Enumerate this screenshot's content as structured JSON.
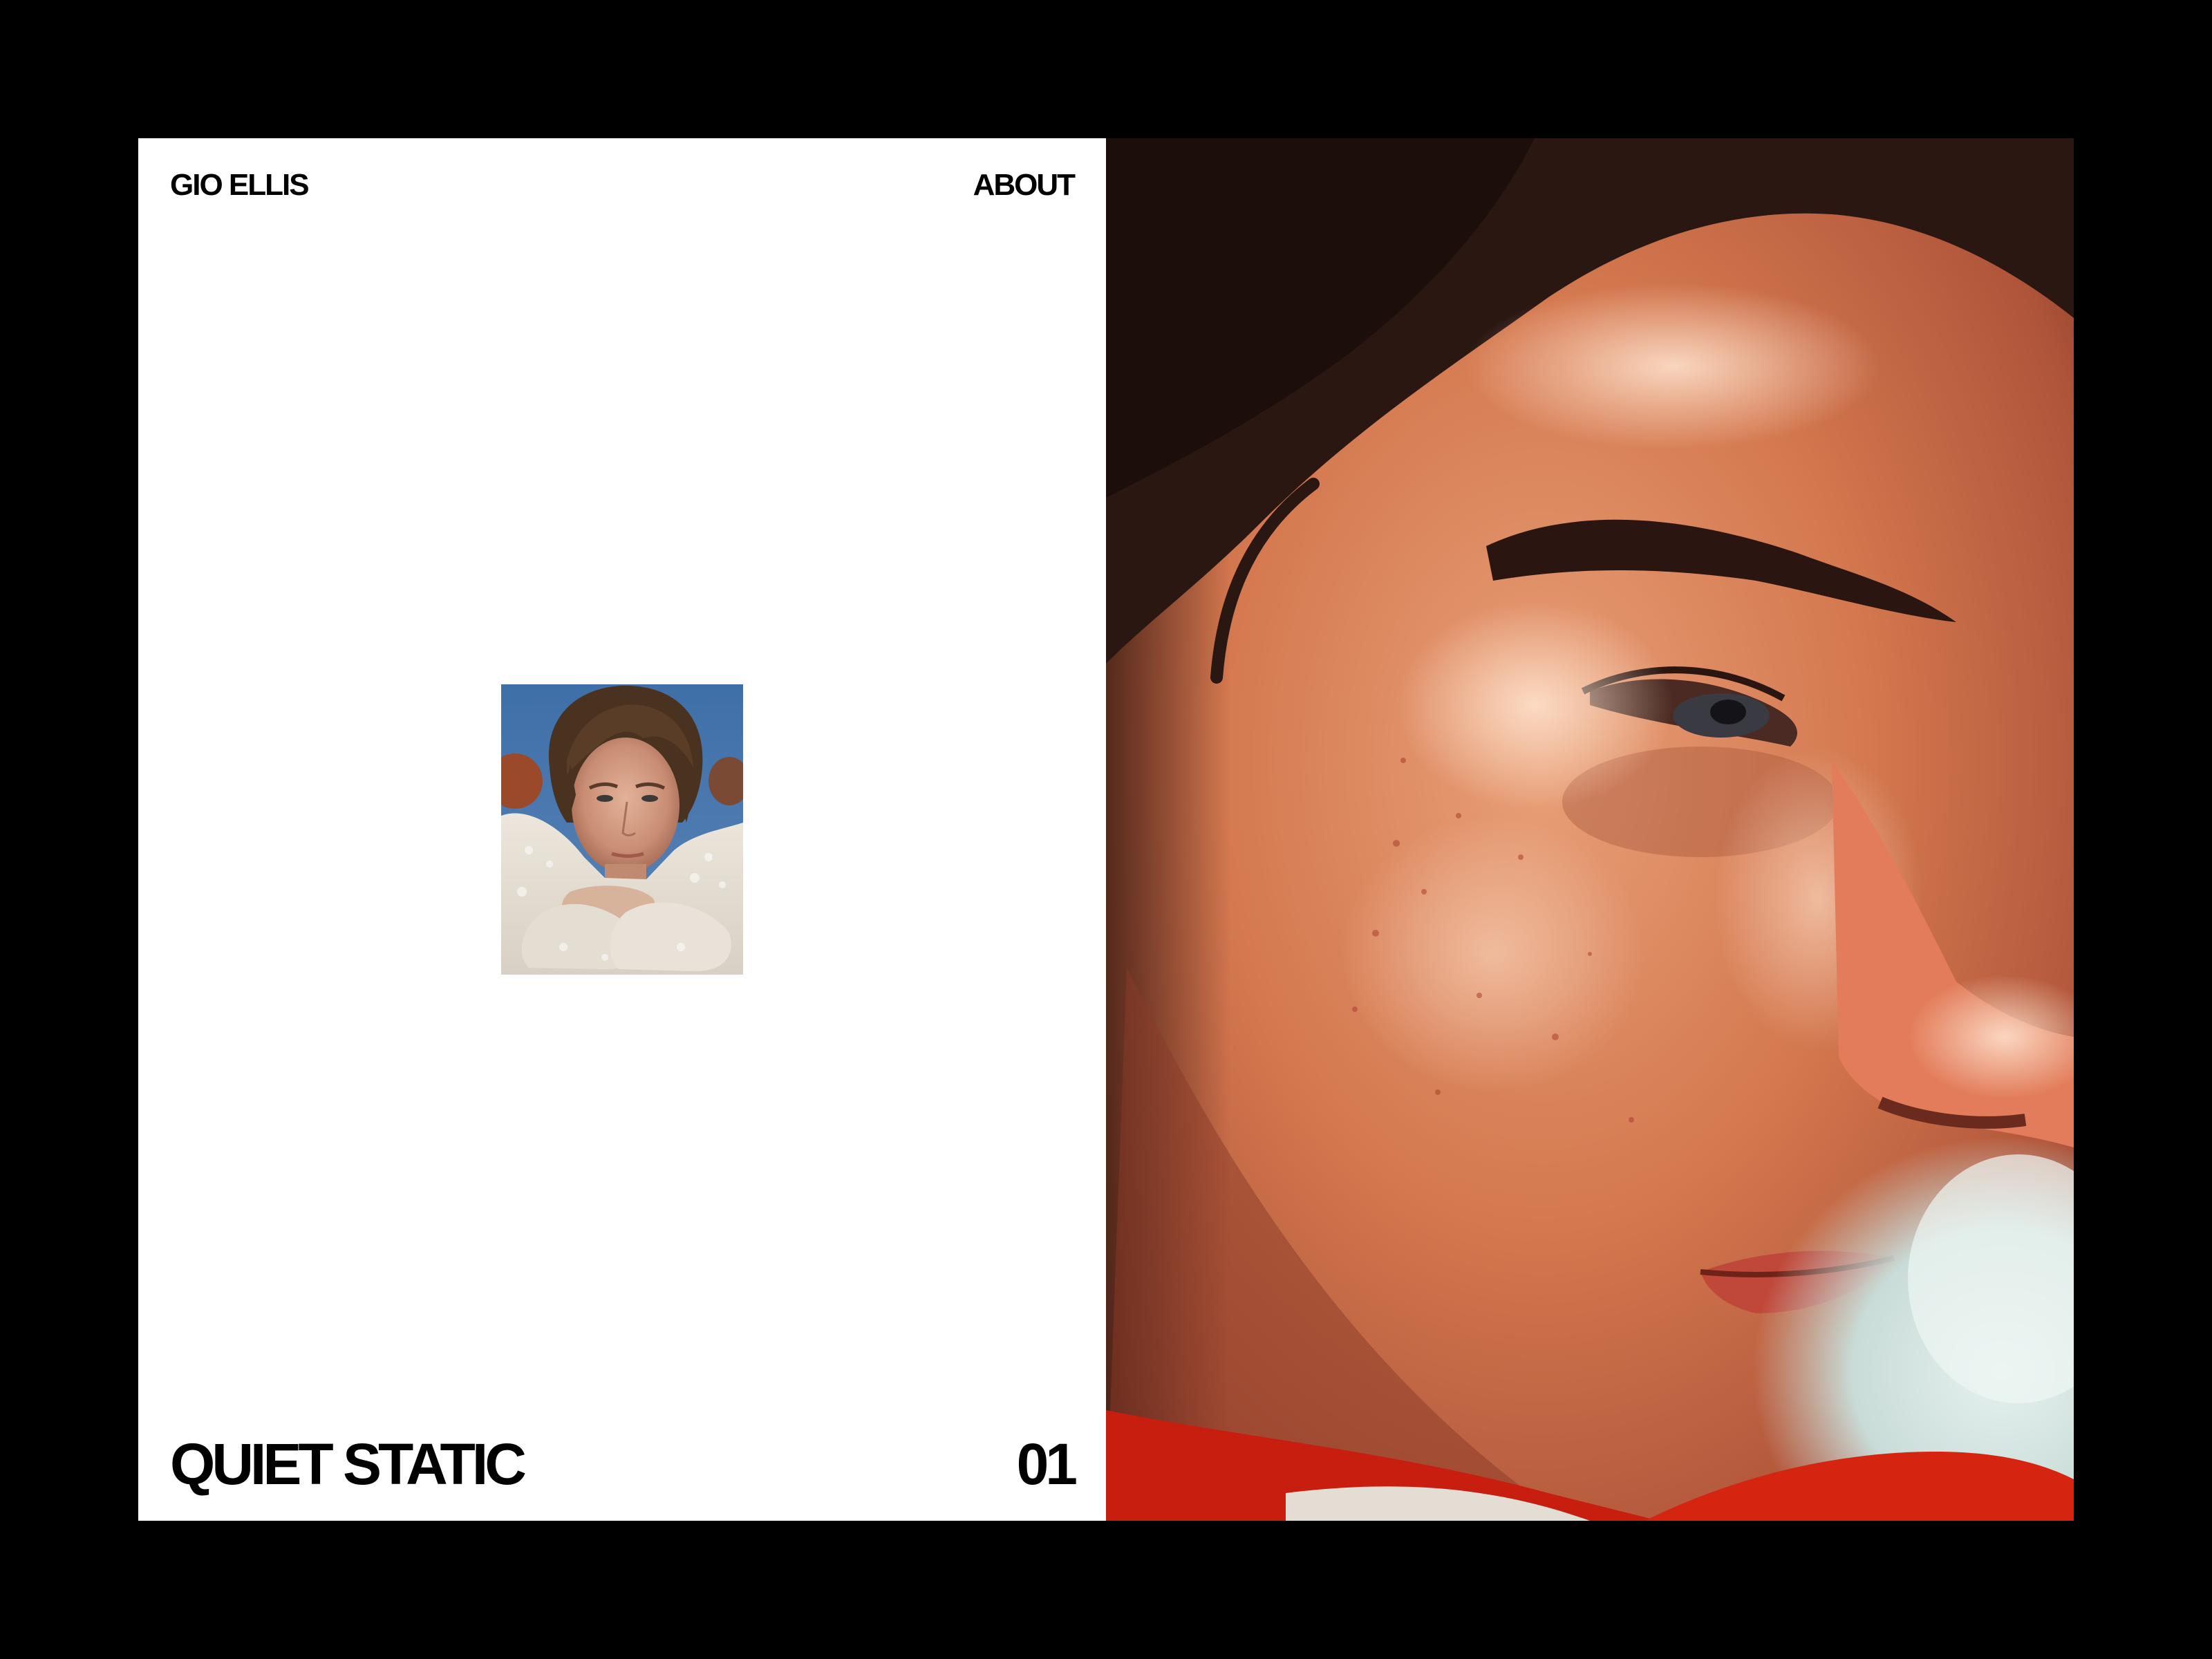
{
  "header": {
    "brand": "GIO ELLIS",
    "about_label": "ABOUT"
  },
  "project": {
    "title": "QUIET STATIC",
    "index": "01"
  },
  "colors": {
    "page_background": "#000000",
    "panel_background": "#ffffff",
    "text": "#000000"
  }
}
